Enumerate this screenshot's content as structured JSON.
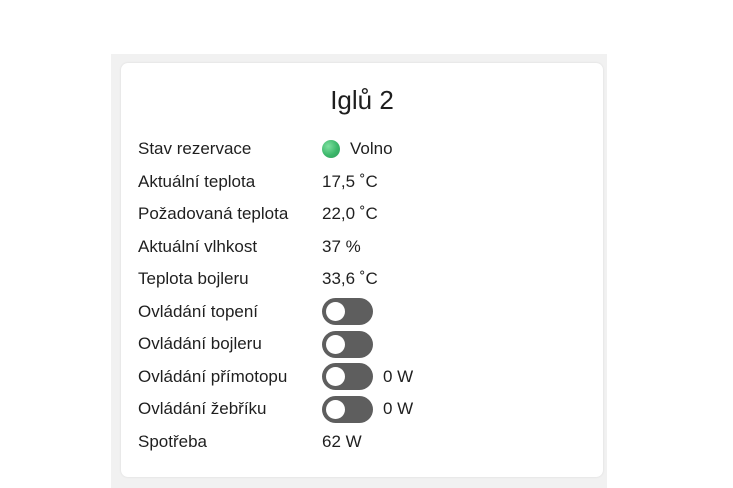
{
  "card": {
    "title": "Iglů 2",
    "rows": [
      {
        "label": "Stav rezervace",
        "value": "Volno",
        "status_color": "#3cb76a"
      },
      {
        "label": "Aktuální teplota",
        "value": "17,5 ˚C"
      },
      {
        "label": "Požadovaná teplota",
        "value": "22,0 ˚C"
      },
      {
        "label": "Aktuální vlhkost",
        "value": "37 %"
      },
      {
        "label": "Teplota bojleru",
        "value": "33,6 ˚C"
      },
      {
        "label": "Ovládání topení",
        "toggle": "off"
      },
      {
        "label": "Ovládání bojleru",
        "toggle": "off"
      },
      {
        "label": "Ovládání přímotopu",
        "toggle": "off",
        "value": "0 W"
      },
      {
        "label": "Ovládání žebříku",
        "toggle": "off",
        "value": "0 W"
      },
      {
        "label": "Spotřeba",
        "value": "62 W"
      }
    ]
  },
  "colors": {
    "toggle_off": "#5e5e5e",
    "status_free": "#3cb76a"
  }
}
